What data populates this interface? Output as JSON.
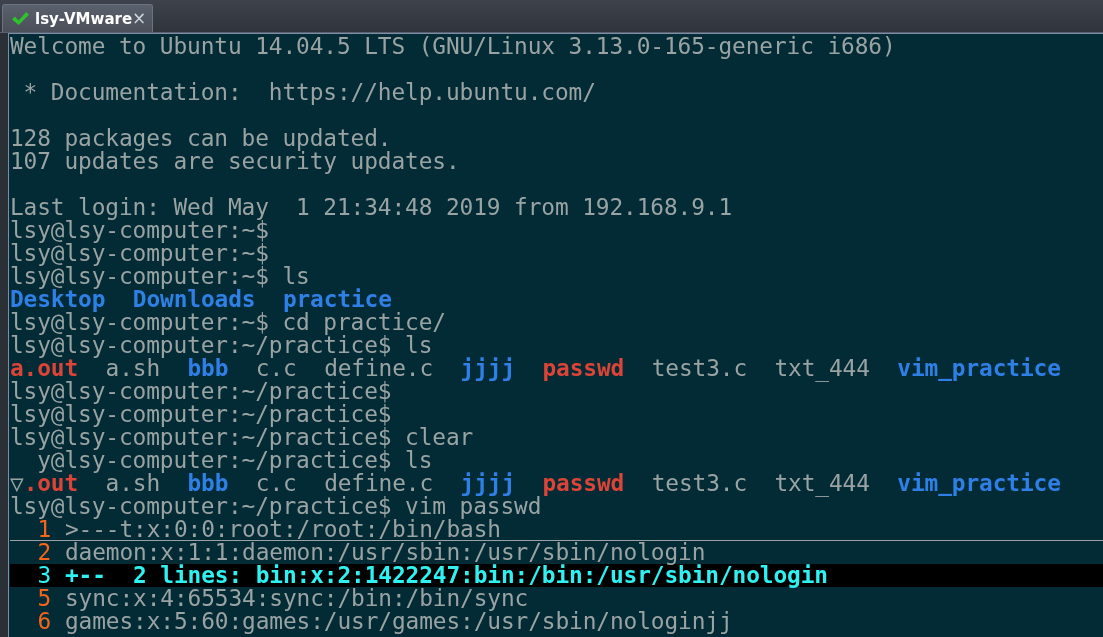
{
  "tab": {
    "title": "lsy-VMware",
    "close": "×",
    "selected": true
  },
  "terminal": {
    "lines": [
      {
        "kind": "text",
        "text": "Welcome to Ubuntu 14.04.5 LTS (GNU/Linux 3.13.0-165-generic i686)"
      },
      {
        "kind": "blank"
      },
      {
        "kind": "text",
        "text": " * Documentation:  https://help.ubuntu.com/"
      },
      {
        "kind": "blank"
      },
      {
        "kind": "text",
        "text": "128 packages can be updated."
      },
      {
        "kind": "text",
        "text": "107 updates are security updates."
      },
      {
        "kind": "blank"
      },
      {
        "kind": "text",
        "text": "Last login: Wed May  1 21:34:48 2019 from 192.168.9.1"
      },
      {
        "kind": "text",
        "text": "lsy@lsy-computer:~$"
      },
      {
        "kind": "text",
        "text": "lsy@lsy-computer:~$"
      },
      {
        "kind": "text",
        "text": "lsy@lsy-computer:~$ ls"
      },
      {
        "kind": "listing",
        "items": [
          {
            "text": "Desktop",
            "kind": "dir"
          },
          {
            "text": "Downloads",
            "kind": "dir"
          },
          {
            "text": "practice",
            "kind": "dir"
          }
        ]
      },
      {
        "kind": "text",
        "text": "lsy@lsy-computer:~$ cd practice/"
      },
      {
        "kind": "text",
        "text": "lsy@lsy-computer:~/practice$ ls"
      },
      {
        "kind": "listing",
        "items": [
          {
            "text": "a.out",
            "kind": "exec"
          },
          {
            "text": "a.sh",
            "kind": "file"
          },
          {
            "text": "bbb",
            "kind": "dir"
          },
          {
            "text": "c.c",
            "kind": "file"
          },
          {
            "text": "define.c",
            "kind": "file"
          },
          {
            "text": "jjjj",
            "kind": "dir"
          },
          {
            "text": "passwd",
            "kind": "exec"
          },
          {
            "text": "test3.c",
            "kind": "file"
          },
          {
            "text": "txt_444",
            "kind": "file"
          },
          {
            "text": "vim_practice",
            "kind": "dir"
          }
        ]
      },
      {
        "kind": "text",
        "text": "lsy@lsy-computer:~/practice$"
      },
      {
        "kind": "text",
        "text": "lsy@lsy-computer:~/practice$"
      },
      {
        "kind": "text",
        "text": "lsy@lsy-computer:~/practice$ clear"
      },
      {
        "kind": "text",
        "text": "  y@lsy-computer:~/practice$ ls"
      },
      {
        "kind": "listing",
        "items": [
          {
            "text": "▽",
            "kind": "mark"
          },
          {
            "text": ".out",
            "kind": "exec"
          },
          {
            "text": "a.sh",
            "kind": "file"
          },
          {
            "text": "bbb",
            "kind": "dir"
          },
          {
            "text": "c.c",
            "kind": "file"
          },
          {
            "text": "define.c",
            "kind": "file"
          },
          {
            "text": "jjjj",
            "kind": "dir"
          },
          {
            "text": "passwd",
            "kind": "exec"
          },
          {
            "text": "test3.c",
            "kind": "file"
          },
          {
            "text": "txt_444",
            "kind": "file"
          },
          {
            "text": "vim_practice",
            "kind": "dir"
          }
        ]
      },
      {
        "kind": "text",
        "text": "lsy@lsy-computer:~/practice$ vim passwd"
      },
      {
        "kind": "vim",
        "number": "1",
        "text": ">---t:x:0:0:root:/root:/bin/bash",
        "cursor": true
      },
      {
        "kind": "vim",
        "number": "2",
        "text": "daemon:x:1:1:daemon:/usr/sbin:/usr/sbin/nologin",
        "cursor": false
      },
      {
        "kind": "fold",
        "number": "3",
        "text": "+--  2 lines: bin:x:2:1422247:bin:/bin:/usr/sbin/nologin"
      },
      {
        "kind": "vim",
        "number": "5",
        "text": "sync:x:4:65534:sync:/bin:/bin/sync",
        "cursor": false
      },
      {
        "kind": "vim",
        "number": "6",
        "text": "games:x:5:60:games:/usr/games:/usr/sbin/nologinjj",
        "cursor": false
      }
    ]
  }
}
